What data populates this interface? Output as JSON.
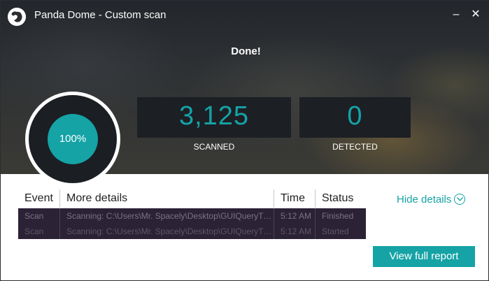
{
  "window": {
    "title": "Panda Dome - Custom scan",
    "minimize_label": "–",
    "close_label": "✕"
  },
  "scan": {
    "status": "Done!",
    "progress_text": "100%",
    "progress": 1.0,
    "scanned_value": "3,125",
    "scanned_label": "SCANNED",
    "detected_value": "0",
    "detected_label": "DETECTED"
  },
  "table": {
    "headers": [
      "Event",
      "More details",
      "Time",
      "Status"
    ],
    "rows": [
      {
        "event": "Scan",
        "details": "Scanning: C:\\Users\\Mr. Spacely\\Desktop\\GUIQueryT…",
        "time": "5:12 AM",
        "status": "Finished"
      },
      {
        "event": "Scan",
        "details": "Scanning: C:\\Users\\Mr. Spacely\\Desktop\\GUIQueryT…",
        "time": "5:12 AM",
        "status": "Started"
      }
    ]
  },
  "actions": {
    "hide_details": "Hide details",
    "view_report": "View full report"
  },
  "colors": {
    "accent": "#15a3a6",
    "rows_bg": "#2b2236"
  },
  "icons": [
    "panda-logo-icon",
    "minimize-icon",
    "close-icon",
    "chevron-down-icon"
  ]
}
